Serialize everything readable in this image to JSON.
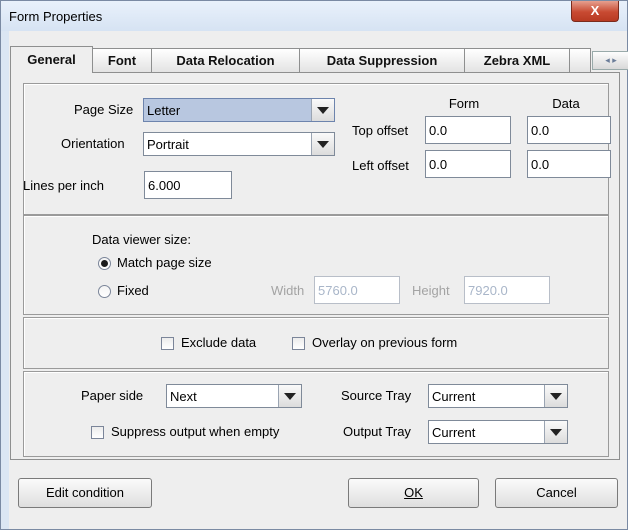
{
  "window": {
    "title": "Form Properties",
    "close_glyph": "X"
  },
  "tabs": [
    {
      "label": "General",
      "active": true
    },
    {
      "label": "Font"
    },
    {
      "label": "Data Relocation"
    },
    {
      "label": "Data Suppression"
    },
    {
      "label": "Zebra XML"
    }
  ],
  "tab_nav_glyph": "◂ ▸",
  "page": {
    "page_size_label": "Page Size",
    "page_size_value": "Letter",
    "orientation_label": "Orientation",
    "orientation_value": "Portrait",
    "lines_per_inch_label": "Lines per inch",
    "lines_per_inch_value": "6.000",
    "col_form": "Form",
    "col_data": "Data",
    "top_offset_label": "Top offset",
    "top_offset_form": "0.0",
    "top_offset_data": "0.0",
    "left_offset_label": "Left offset",
    "left_offset_form": "0.0",
    "left_offset_data": "0.0"
  },
  "viewer": {
    "heading": "Data viewer size:",
    "match_label": "Match page size",
    "fixed_label": "Fixed",
    "width_label": "Width",
    "width_value": "5760.0",
    "height_label": "Height",
    "height_value": "7920.0"
  },
  "options": {
    "exclude_label": "Exclude data",
    "overlay_label": "Overlay on previous form"
  },
  "output": {
    "paper_side_label": "Paper side",
    "paper_side_value": "Next",
    "source_tray_label": "Source Tray",
    "source_tray_value": "Current",
    "suppress_label": "Suppress output when empty",
    "output_tray_label": "Output Tray",
    "output_tray_value": "Current"
  },
  "buttons": {
    "edit_condition": "Edit condition",
    "ok": "OK",
    "cancel": "Cancel"
  }
}
